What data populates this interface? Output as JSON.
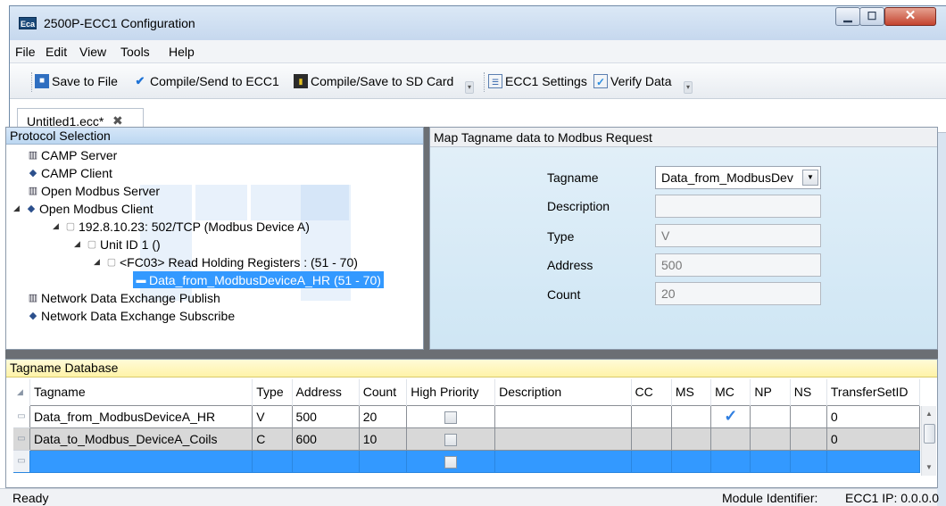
{
  "window": {
    "title": "2500P-ECC1 Configuration",
    "icon_text": "Eca"
  },
  "menu": [
    "File",
    "Edit",
    "View",
    "Tools",
    "Help"
  ],
  "toolbar": {
    "save": "Save to File",
    "compile_send": "Compile/Send to ECC1",
    "compile_sd": "Compile/Save to SD Card",
    "settings": "ECC1 Settings",
    "verify": "Verify Data"
  },
  "doc_tab": {
    "label": "Untitled1.ecc*",
    "close": "✖"
  },
  "protocol": {
    "header": "Protocol Selection",
    "tree": [
      {
        "label": "CAMP Server",
        "icon": "server-icon"
      },
      {
        "label": "CAMP Client",
        "icon": "client-icon"
      },
      {
        "label": "Open Modbus Server",
        "icon": "server-icon"
      },
      {
        "label": "Open Modbus Client",
        "icon": "client-icon",
        "expanded": true
      },
      {
        "label": "192.8.10.23: 502/TCP (Modbus Device A)",
        "icon": "document-icon",
        "expanded": true
      },
      {
        "label": "Unit ID 1 ()",
        "icon": "document-icon",
        "expanded": true
      },
      {
        "label": "<FC03> Read Holding Registers : (51 - 70)",
        "icon": "document-icon",
        "expanded": true
      },
      {
        "label": "Data_from_ModbusDeviceA_HR (51 - 70)",
        "icon": "tag-icon",
        "selected": true
      },
      {
        "label": "Network Data Exchange Publish",
        "icon": "server-icon"
      },
      {
        "label": "Network Data Exchange Subscribe",
        "icon": "client-icon"
      }
    ]
  },
  "map": {
    "header": "Map Tagname data to Modbus Request",
    "labels": {
      "tagname": "Tagname",
      "description": "Description",
      "type": "Type",
      "address": "Address",
      "count": "Count"
    },
    "values": {
      "tagname": "Data_from_ModbusDev",
      "description": "",
      "type": "V",
      "address": "500",
      "count": "20"
    }
  },
  "database": {
    "header": "Tagname Database",
    "columns": [
      "Tagname",
      "Type",
      "Address",
      "Count",
      "High Priority",
      "Description",
      "CC",
      "MS",
      "MC",
      "NP",
      "NS",
      "TransferSetID"
    ],
    "rows": [
      {
        "tagname": "Data_from_ModbusDeviceA_HR",
        "type": "V",
        "address": "500",
        "count": "20",
        "high_priority": false,
        "description": "",
        "cc": "",
        "ms": "",
        "mc": true,
        "np": "",
        "ns": "",
        "transfer": "0"
      },
      {
        "tagname": "Data_to_Modbus_DeviceA_Coils",
        "type": "C",
        "address": "600",
        "count": "10",
        "high_priority": false,
        "description": "",
        "cc": "",
        "ms": "",
        "mc": false,
        "np": "",
        "ns": "",
        "transfer": "0"
      },
      {
        "tagname": "",
        "type": "",
        "address": "",
        "count": "",
        "high_priority": false,
        "description": "",
        "cc": "",
        "ms": "",
        "mc": false,
        "np": "",
        "ns": "",
        "transfer": ""
      }
    ]
  },
  "status": {
    "ready": "Ready",
    "module": "Module Identifier:",
    "ip": "ECC1 IP: 0.0.0.0"
  },
  "colors": {
    "selection": "#3399ff",
    "splitter": "#6b6f74",
    "db_header": "#fff3a8",
    "proto_header": "#bcd7f1"
  }
}
